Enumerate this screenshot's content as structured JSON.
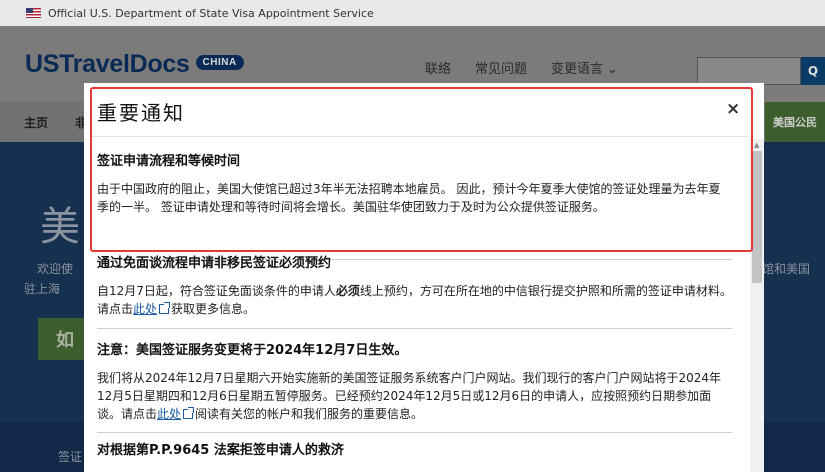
{
  "topbar": {
    "text": "Official U.S. Department of State Visa Appointment Service"
  },
  "header": {
    "logo": "USTravelDocs",
    "badge": "CHINA",
    "links": [
      "联络",
      "常见问题",
      "变更语言 ⌄"
    ],
    "search_button": "Q"
  },
  "nav": {
    "home": "主页",
    "second": "非",
    "citizen": "美国公民"
  },
  "hero": {
    "char": "美",
    "text1": "欢迎使",
    "text2": "驻上海",
    "right": "馆和美国",
    "button": "如"
  },
  "footer": {
    "text": "签证"
  },
  "modal": {
    "title": "重要通知",
    "close": "×",
    "sections": [
      {
        "heading": "签证申请流程和等候时间",
        "body": "由于中国政府的阻止，美国大使馆已超过3年半无法招聘本地雇员。 因此，预计今年夏季大使馆的签证处理量为去年夏季的一半。 签证申请处理和等待时间将会增长。美国驻华使团致力于及时为公众提供签证服务。"
      },
      {
        "heading": "通过免面谈流程申请非移民签证必须预约",
        "body_before": "自12月7日起，符合签证免面谈条件的申请人",
        "body_bold": "必须",
        "body_mid": "线上预约，方可在所在地的中信银行提交护照和所需的签证申请材料。请点击",
        "link": "此处",
        "body_after": "获取更多信息。"
      },
      {
        "heading": "注意：美国签证服务变更将于2024年12月7日生效。",
        "body_before": "我们将从2024年12月7日星期六开始实施新的美国签证服务系统客户门户网站。我们现行的客户门户网站将于2024年12月5日星期四和12月6日星期五暂停服务。已经预约2024年12月5日或12月6日的申请人，应按照预约日期参加面谈。请点击",
        "link": "此处",
        "body_after": "阅读有关您的帐户和我们服务的重要信息。"
      },
      {
        "heading": "对根据第P.P.9645 法案拒签申请人的救济"
      }
    ]
  },
  "colors": {
    "highlight": "#e53935",
    "link": "#1a5aa6"
  }
}
